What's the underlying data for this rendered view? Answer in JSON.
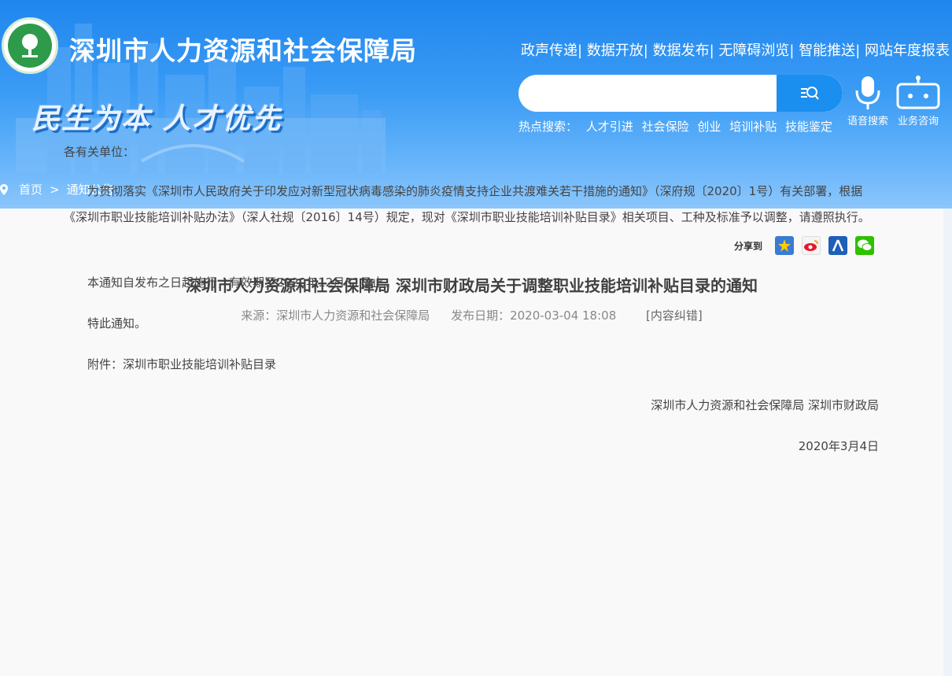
{
  "header": {
    "site_title": "深圳市人力资源和社会保障局",
    "slogan": "民生为本  人才优先",
    "top_links": [
      "政声传递",
      "数据开放",
      "数据发布",
      "无障碍浏览",
      "智能推送",
      "网站年度报表"
    ],
    "search": {
      "value": "",
      "placeholder": ""
    },
    "hot_label": "热点搜索：",
    "hot_terms": [
      "人才引进",
      "社会保险",
      "创业",
      "培训补贴",
      "技能鉴定"
    ],
    "voice_search": "语音搜索",
    "consult": "业务咨询"
  },
  "breadcrumb": {
    "home": "首页",
    "sep": ">",
    "current": "通知公告"
  },
  "share": {
    "label": "分享到"
  },
  "article": {
    "title": "深圳市人力资源和社会保障局 深圳市财政局关于调整职业技能培训补贴目录的通知",
    "source": "来源：深圳市人力资源和社会保障局",
    "date": "发布日期：2020-03-04 18:08",
    "correction": "[内容纠错]",
    "salutation": "各有关单位：",
    "para1": "为贯彻落实《深圳市人民政府关于印发应对新型冠状病毒感染的肺炎疫情支持企业共渡难关若干措施的通知》（深府规〔2020〕1号）有关部署，根据《深圳市职业技能培训补贴办法》（深人社规〔2016〕14号）规定，现对《深圳市职业技能培训补贴目录》相关项目、工种及标准予以调整，请遵照执行。",
    "para2": "本通知自发布之日起施行，有效期至2020年12月31日止。",
    "para3": "特此通知。",
    "attachment": "附件：深圳市职业技能培训补贴目录",
    "signature": "深圳市人力资源和社会保障局 深圳市财政局",
    "sign_date": "2020年3月4日"
  },
  "colors": {
    "header_blue": "#1f86ee",
    "search_btn": "#1b8ff0",
    "logo_green": "#2e9b4a"
  }
}
